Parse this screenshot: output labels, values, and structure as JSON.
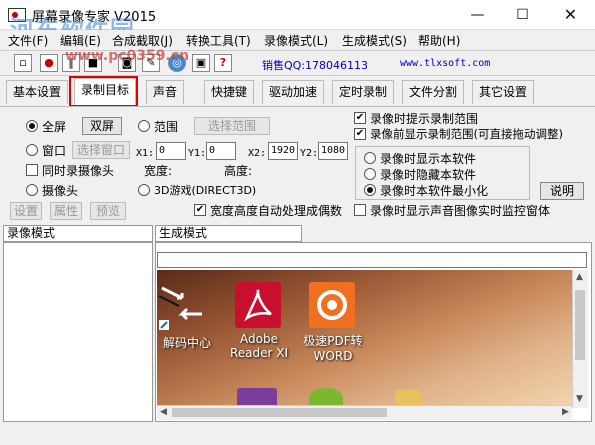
{
  "window": {
    "title": "屏幕录像专家 V2015",
    "watermark": "河东软件园",
    "watermark_url": "www.pc0359.cn"
  },
  "controls": {
    "minimize": "—",
    "maximize": "☐",
    "close": "✕"
  },
  "menu": [
    "文件(F)",
    "编辑(E)",
    "合成截取(J)",
    "转换工具(T)",
    "录像模式(L)",
    "生成模式(S)",
    "帮助(H)"
  ],
  "toolbar": {
    "qq": "销售QQ:178046113",
    "site": "www.tlxsoft.com"
  },
  "tabs": [
    "基本设置",
    "录制目标",
    "声音",
    "快捷键",
    "驱动加速",
    "定时录制",
    "文件分割",
    "其它设置"
  ],
  "active_tab": "录制目标",
  "target": {
    "fullscreen": "全屏",
    "dual_screen": "双屏",
    "range": "范围",
    "select_range": "选择范围",
    "window": "窗口",
    "select_window": "选择窗口",
    "camera_also": "同时录摄像头",
    "camera": "摄像头",
    "game": "3D游戏(DIRECT3D)",
    "x1_label": "X1:",
    "x1": "0",
    "y1_label": "Y1:",
    "y1": "0",
    "x2_label": "X2:",
    "x2": "1920",
    "y2_label": "Y2:",
    "y2": "1080",
    "width_label": "宽度:",
    "height_label": "高度:",
    "settings": "设置",
    "properties": "属性",
    "preview": "预览",
    "even_dims": "宽度高度自动处理成偶数"
  },
  "right_opts": {
    "show_range_hint": "录像时提示录制范围",
    "show_range_before": "录像前显示录制范围(可直接拖动调整)",
    "show_software": "录像时显示本软件",
    "hide_software": "录像时隐藏本软件",
    "minimize_software": "录像时本软件最小化",
    "help": "说明",
    "sound_monitor": "录像时显示声音图像实时监控窗体"
  },
  "bottom": {
    "left_label": "录像模式",
    "right_label": "生成模式"
  },
  "desktop_icons": [
    {
      "label": "解码中心",
      "icon": "decode-center-icon"
    },
    {
      "label": "Adobe\nReader XI",
      "icon": "adobe-reader-icon"
    },
    {
      "label": "极速PDF转\nWORD",
      "icon": "pdf-to-word-icon"
    }
  ],
  "colors": {
    "highlight": "#e00000",
    "link": "#0000c0"
  }
}
